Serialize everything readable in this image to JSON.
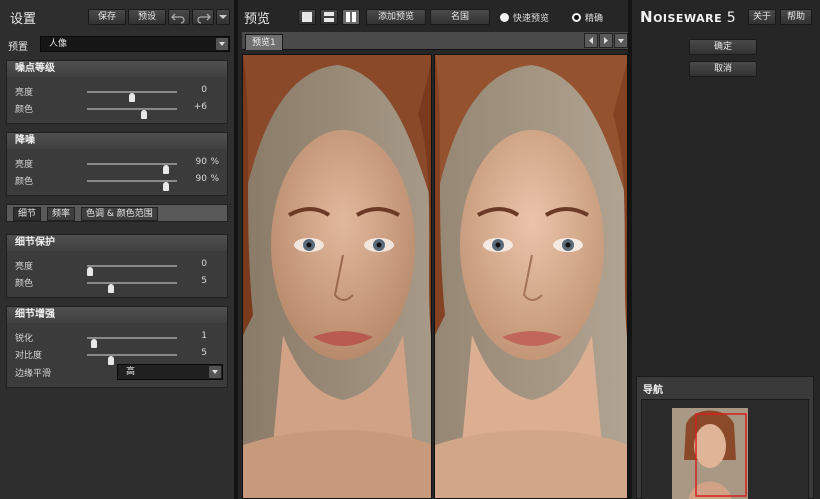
{
  "left": {
    "title": "设置",
    "save_label": "保存",
    "preset_btn_label": "预设",
    "preset_label": "预置",
    "preset_value": "人像",
    "noise_level": {
      "title": "噪点等级",
      "rows": [
        {
          "label": "亮度",
          "value": "0",
          "unit": "",
          "level": 0.5
        },
        {
          "label": "颜色",
          "value": "+6",
          "unit": "",
          "level": 0.64
        }
      ]
    },
    "noise_reduction": {
      "title": "降噪",
      "rows": [
        {
          "label": "亮度",
          "value": "90",
          "unit": "%",
          "level": 0.9
        },
        {
          "label": "颜色",
          "value": "90",
          "unit": "%",
          "level": 0.9
        }
      ]
    },
    "tabs": [
      "细节",
      "频率",
      "色调 & 颜色范围"
    ],
    "detail_protection": {
      "title": "细节保护",
      "rows": [
        {
          "label": "亮度",
          "value": "0",
          "unit": "",
          "level": 0.0
        },
        {
          "label": "颜色",
          "value": "5",
          "unit": "",
          "level": 0.25
        }
      ]
    },
    "detail_enhance": {
      "title": "细节增强",
      "rows": [
        {
          "label": "锐化",
          "value": "1",
          "unit": "",
          "level": 0.05
        },
        {
          "label": "对比度",
          "value": "5",
          "unit": "",
          "level": 0.25
        }
      ],
      "edge_label": "边缘平滑",
      "edge_value": "高"
    }
  },
  "center": {
    "title": "预览",
    "add_preview_label": "添加预览",
    "original_label": "名国",
    "fast_preview_label": "快速预览",
    "precise_label": "精确",
    "tab_label": "预览1"
  },
  "right": {
    "logo_big": "N",
    "logo_small": "OISEWARE",
    "logo_num": "5",
    "about_label": "关于",
    "help_label": "帮助",
    "ok_label": "确定",
    "cancel_label": "取消",
    "navigator_title": "导航"
  },
  "colors": {
    "panel": "#2e2e2e",
    "section": "#3b3b3b",
    "nav_rect": "#d42020"
  },
  "icons": [
    "undo-icon",
    "redo-icon",
    "dropdown-icon",
    "single-view-icon",
    "split-horizontal-icon",
    "split-vertical-icon",
    "arrow-left-icon",
    "arrow-right-icon"
  ]
}
